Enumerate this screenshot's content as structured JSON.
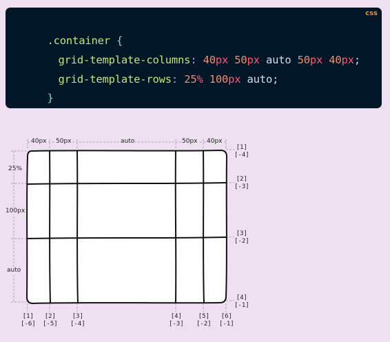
{
  "code": {
    "language": "css",
    "selector": ".container",
    "open_brace": "{",
    "close_brace": "}",
    "line1": {
      "property": "grid-template-columns",
      "values": [
        {
          "num": "40",
          "unit": "px"
        },
        {
          "num": "50",
          "unit": "px"
        },
        {
          "kw": "auto"
        },
        {
          "num": "50",
          "unit": "px"
        },
        {
          "num": "40",
          "unit": "px"
        }
      ]
    },
    "line2": {
      "property": "grid-template-rows",
      "values": [
        {
          "num": "25",
          "unit": "%"
        },
        {
          "num": "100",
          "unit": "px"
        },
        {
          "kw": "auto"
        }
      ]
    }
  },
  "diagram": {
    "column_sizes": [
      "40px",
      "50px",
      "auto",
      "50px",
      "40px"
    ],
    "row_sizes": [
      "25%",
      "100px",
      "auto"
    ],
    "column_lines": [
      {
        "pos": "[1]",
        "neg": "[-6]"
      },
      {
        "pos": "[2]",
        "neg": "[-5]"
      },
      {
        "pos": "[3]",
        "neg": "[-4]"
      },
      {
        "pos": "[4]",
        "neg": "[-3]"
      },
      {
        "pos": "[5]",
        "neg": "[-2]"
      },
      {
        "pos": "[6]",
        "neg": "[-1]"
      }
    ],
    "row_lines": [
      {
        "pos": "[1]",
        "neg": "[-4]"
      },
      {
        "pos": "[2]",
        "neg": "[-3]"
      },
      {
        "pos": "[3]",
        "neg": "[-2]"
      },
      {
        "pos": "[4]",
        "neg": "[-1]"
      }
    ]
  }
}
